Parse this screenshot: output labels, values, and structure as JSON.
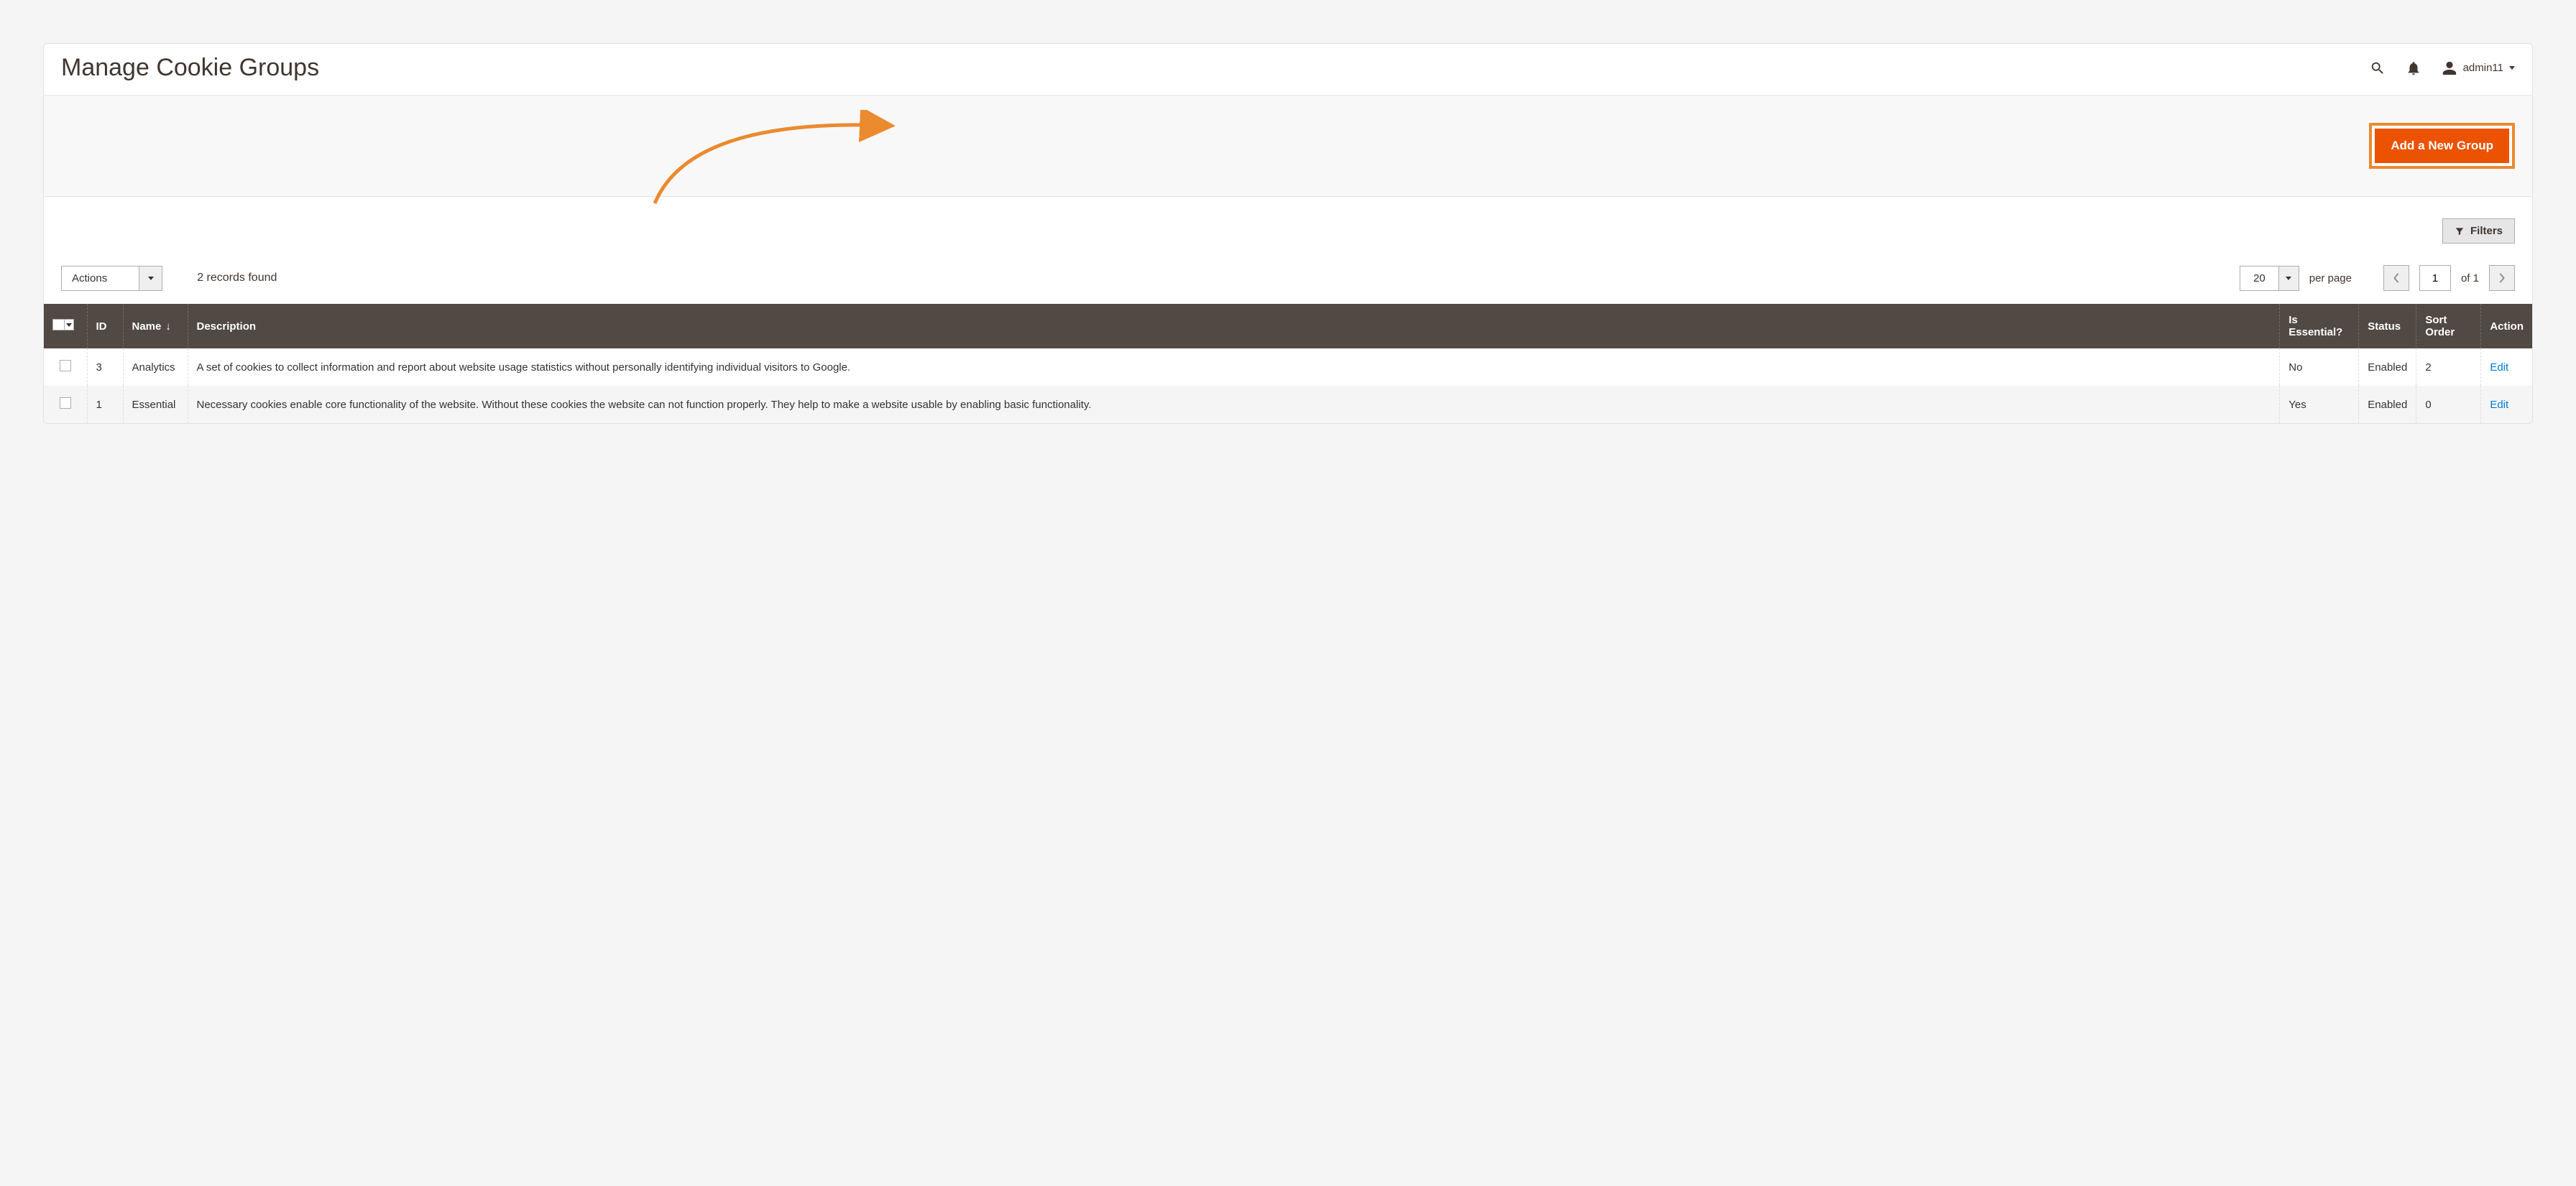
{
  "page": {
    "title": "Manage Cookie Groups"
  },
  "header": {
    "username": "admin11"
  },
  "actionbar": {
    "primary_label": "Add a New Group"
  },
  "filters": {
    "label": "Filters"
  },
  "controls": {
    "actions_label": "Actions",
    "records_found": "2 records found",
    "per_page_value": "20",
    "per_page_label": "per page",
    "current_page": "1",
    "total_pages_label": "of 1"
  },
  "grid": {
    "columns": {
      "id": "ID",
      "name": "Name",
      "description": "Description",
      "is_essential": "Is Essential?",
      "status": "Status",
      "sort_order": "Sort Order",
      "action": "Action"
    },
    "rows": [
      {
        "id": "3",
        "name": "Analytics",
        "description": "A set of cookies to collect information and report about website usage statistics without personally identifying individual visitors to Google.",
        "is_essential": "No",
        "status": "Enabled",
        "sort_order": "2",
        "action": "Edit"
      },
      {
        "id": "1",
        "name": "Essential",
        "description": "Necessary cookies enable core functionality of the website. Without these cookies the website can not function properly. They help to make a website usable by enabling basic functionality.",
        "is_essential": "Yes",
        "status": "Enabled",
        "sort_order": "0",
        "action": "Edit"
      }
    ]
  }
}
